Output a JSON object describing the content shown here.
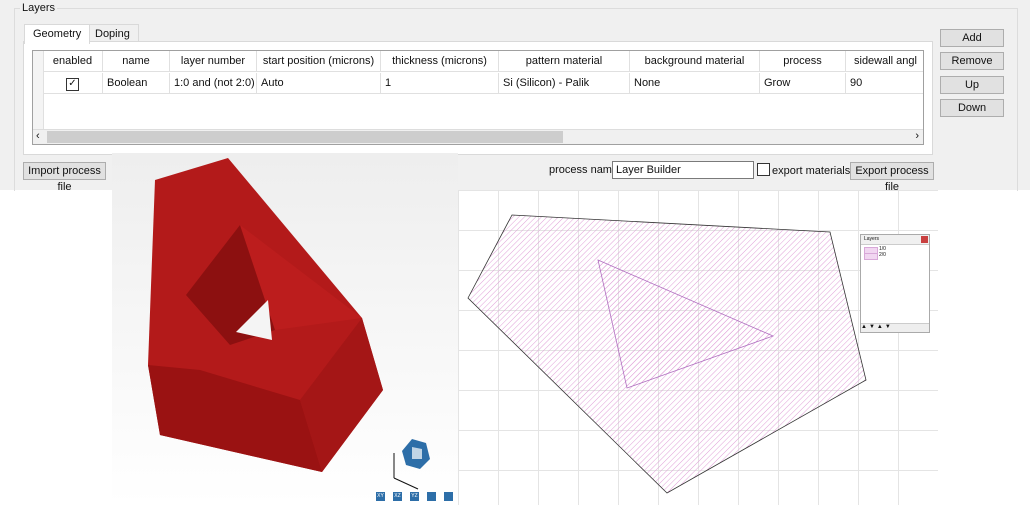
{
  "group_title": "Layers",
  "tabs": [
    {
      "label": "Geometry",
      "active": true
    },
    {
      "label": "Doping",
      "active": false
    }
  ],
  "table": {
    "columns": [
      "enabled",
      "name",
      "layer number",
      "start position (microns)",
      "thickness (microns)",
      "pattern material",
      "background material",
      "process",
      "sidewall angl"
    ],
    "rows": [
      {
        "enabled": true,
        "name": "Boolean",
        "layer_number": "1:0 and (not 2:0)",
        "start_position": "Auto",
        "thickness": "1",
        "pattern_material": "Si (Silicon) - Palik",
        "background_material": "None",
        "process": "Grow",
        "sidewall_angle": "90"
      }
    ]
  },
  "buttons": {
    "add": "Add",
    "remove": "Remove",
    "up": "Up",
    "down": "Down",
    "import": "Import process file",
    "export": "Export process file"
  },
  "process_name": {
    "label": "process name",
    "value": "Layer Builder"
  },
  "export_materials": {
    "label": "export materials",
    "checked": false
  },
  "layers_window": {
    "title": "Layers",
    "items": [
      "1/0",
      "2/0"
    ]
  },
  "view_buttons": [
    "XY",
    "XZ",
    "YZ",
    "3D",
    "lock"
  ],
  "colors": {
    "shape": "#b01818",
    "hatch": "#e8a8e0"
  }
}
